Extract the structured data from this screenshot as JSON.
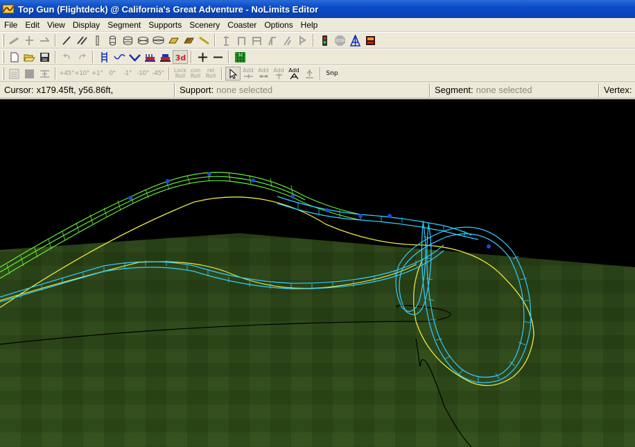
{
  "window": {
    "title": "Top Gun (Flightdeck) @ California's Great Adventure - NoLimits Editor"
  },
  "menu": [
    "File",
    "Edit",
    "View",
    "Display",
    "Segment",
    "Supports",
    "Scenery",
    "Coaster",
    "Options",
    "Help"
  ],
  "toolbar3": {
    "angles": [
      "+45°",
      "+10°",
      "+1°",
      "0°",
      "-1°",
      "-10°",
      "-45°"
    ],
    "lock_roll": [
      "Lock",
      "Roll"
    ],
    "con_roll": [
      "con",
      "Roll"
    ],
    "rel_roll": [
      "rel",
      "Roll"
    ],
    "add1": "Add",
    "add2": "Add",
    "add3": "Add",
    "add4": "Add",
    "snap": "Snp"
  },
  "status": {
    "cursor_label": "Cursor:",
    "cursor_value": "x179.45ft, y56.86ft,",
    "support_label": "Support:",
    "support_value": "none selected",
    "segment_label": "Segment:",
    "segment_value": "none selected",
    "vertex_label": "Vertex:"
  },
  "colors": {
    "track_selected": "#33ccff",
    "track_green": "#66ee33",
    "track_yellow": "#eeee44",
    "ground": "#2f4a1a",
    "sky": "#000000",
    "node": "#2244dd"
  },
  "icons": {
    "app": "coaster-app-icon",
    "traffic_light": "traffic-light-icon",
    "stop": "stop-icon",
    "tower": "blue-tower-icon",
    "train": "train-icon"
  }
}
